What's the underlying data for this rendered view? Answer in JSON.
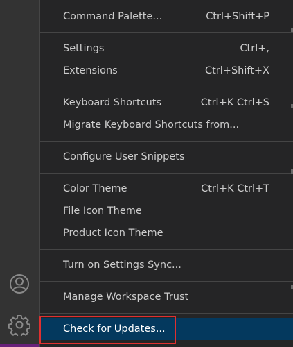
{
  "activity_bar": {
    "icons": [
      "account-icon",
      "gear-icon"
    ]
  },
  "menu": {
    "items": [
      {
        "label": "Command Palette...",
        "shortcut": "Ctrl+Shift+P"
      },
      {
        "label": "Settings",
        "shortcut": "Ctrl+,"
      },
      {
        "label": "Extensions",
        "shortcut": "Ctrl+Shift+X"
      },
      {
        "label": "Keyboard Shortcuts",
        "shortcut": "Ctrl+K Ctrl+S"
      },
      {
        "label": "Migrate Keyboard Shortcuts from...",
        "shortcut": ""
      },
      {
        "label": "Configure User Snippets",
        "shortcut": ""
      },
      {
        "label": "Color Theme",
        "shortcut": "Ctrl+K Ctrl+T"
      },
      {
        "label": "File Icon Theme",
        "shortcut": ""
      },
      {
        "label": "Product Icon Theme",
        "shortcut": ""
      },
      {
        "label": "Turn on Settings Sync...",
        "shortcut": ""
      },
      {
        "label": "Manage Workspace Trust",
        "shortcut": ""
      },
      {
        "label": "Check for Updates...",
        "shortcut": "",
        "selected": true
      }
    ]
  },
  "colors": {
    "menu_background": "#252526",
    "selected_background": "#04395e",
    "highlight_border": "#e03030",
    "text": "#cccccc"
  }
}
